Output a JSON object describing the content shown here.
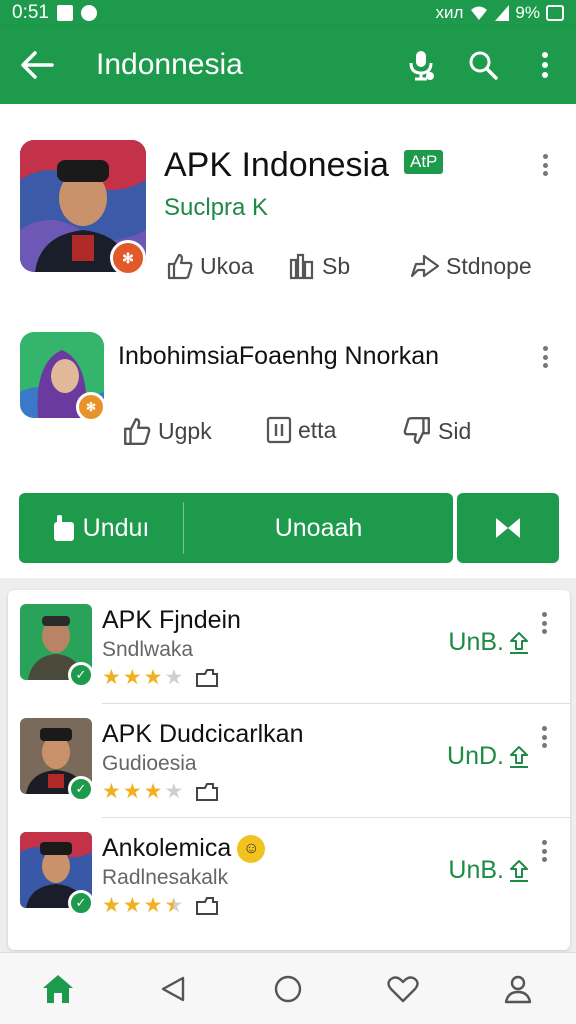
{
  "status_bar": {
    "time": "0:51",
    "battery": "9%",
    "signal": "хил"
  },
  "app_bar": {
    "title": "Indonnesia"
  },
  "main_app": {
    "title": "APK Indonesia",
    "tag": "AtP",
    "developer": "Suclpra K",
    "stats": [
      {
        "label": "Ukoa"
      },
      {
        "label": "Sb"
      },
      {
        "label": "Stdnope"
      }
    ]
  },
  "second_app": {
    "title": "InbohimsiaFoaenhg Nnorkan",
    "stats": [
      {
        "label": "Ugpk"
      },
      {
        "label": "etta"
      },
      {
        "label": "Sіd"
      }
    ]
  },
  "actions": {
    "primary_left": "Unduı",
    "primary_right": "Unoaah"
  },
  "list": [
    {
      "name": "APK Fjndein",
      "subtitle": "Sndlwaka",
      "rating": 3,
      "action": "UnB."
    },
    {
      "name": "APK Dudcicarlkan",
      "subtitle": "Gudioesia",
      "rating": 3,
      "action": "UnD."
    },
    {
      "name": "Ankolemica",
      "subtitle": "Radlnesakalk",
      "rating": 3.5,
      "action": "UnB."
    }
  ],
  "colors": {
    "accent": "#1e9a4c",
    "star": "#f2b01e"
  },
  "bottom_nav": [
    "home-icon",
    "back-triangle-icon",
    "home-circle-icon",
    "heart-icon",
    "profile-icon"
  ]
}
